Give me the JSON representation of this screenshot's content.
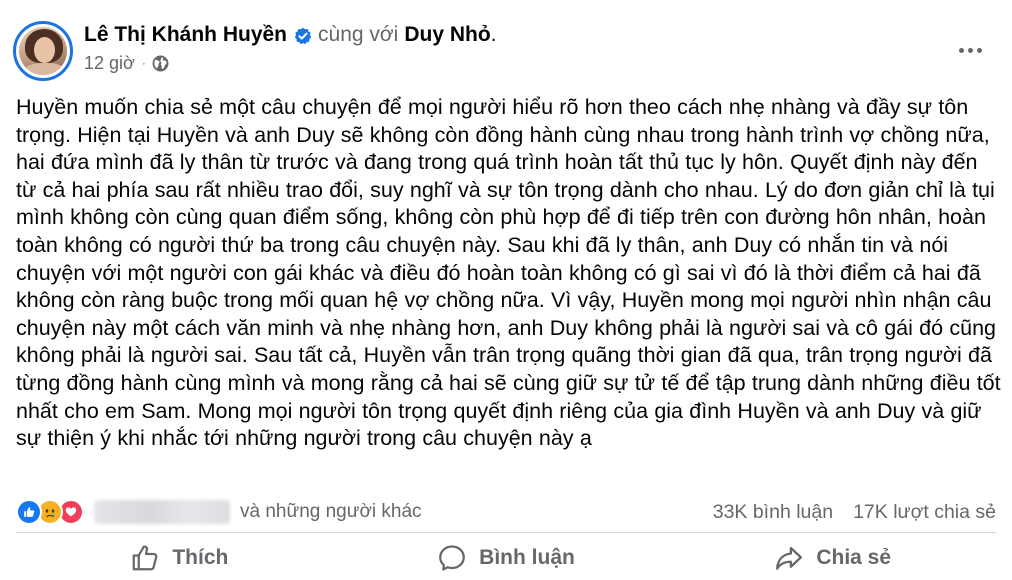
{
  "post": {
    "author": "Lê Thị Khánh Huyền",
    "with_text": "cùng với",
    "tagged": "Duy Nhỏ",
    "tagged_punct": ".",
    "time": "12 giờ",
    "meta_separator": "·",
    "privacy_icon": "globe-icon",
    "body": "Huyền muốn chia sẻ một câu chuyện để mọi người hiểu rõ hơn theo cách nhẹ nhàng và đầy sự tôn trọng. Hiện tại Huyền và anh Duy sẽ không còn đồng hành cùng nhau trong hành trình vợ chồng nữa, hai đứa mình đã ly thân từ trước và đang trong quá trình hoàn tất thủ tục ly hôn. Quyết định này đến từ cả hai phía sau rất nhiều trao đổi, suy nghĩ và sự tôn trọng dành cho nhau. Lý do đơn giản chỉ là tụi mình không còn cùng quan điểm sống, không còn phù hợp để đi tiếp trên con đường hôn nhân, hoàn toàn không có người thứ ba trong câu chuyện này. Sau khi đã ly thân, anh Duy có nhắn tin và nói chuyện với một người con gái khác và điều đó hoàn toàn không có gì sai vì đó là thời điểm cả hai đã không còn ràng buộc trong mối quan hệ vợ chồng nữa. Vì vậy, Huyền mong mọi người nhìn nhận câu chuyện này một cách văn minh và nhẹ nhàng hơn, anh Duy không phải là người sai và cô gái đó cũng không phải là người sai. Sau tất cả, Huyền vẫn trân trọng quãng thời gian đã qua, trân trọng người đã từng đồng hành cùng mình và mong rằng cả hai sẽ cùng giữ sự tử tế để tập trung dành những điều tốt nhất cho em Sam. Mong mọi người tôn trọng quyết định riêng của gia đình Huyền và anh Duy và giữ sự thiện ý khi nhắc tới những người trong câu chuyện này ạ"
  },
  "reactions": {
    "icons": [
      "like-reaction-icon",
      "sad-reaction-icon",
      "love-reaction-icon"
    ],
    "others_text": "và những người khác",
    "comments": "33K bình luận",
    "shares": "17K lượt chia sẻ"
  },
  "actions": {
    "like": "Thích",
    "comment": "Bình luận",
    "share": "Chia sẻ"
  },
  "colors": {
    "accent": "#1b74e4",
    "secondary_text": "#65676b",
    "like": "#1877f2",
    "sad": "#f7b125",
    "love": "#f33e58"
  }
}
